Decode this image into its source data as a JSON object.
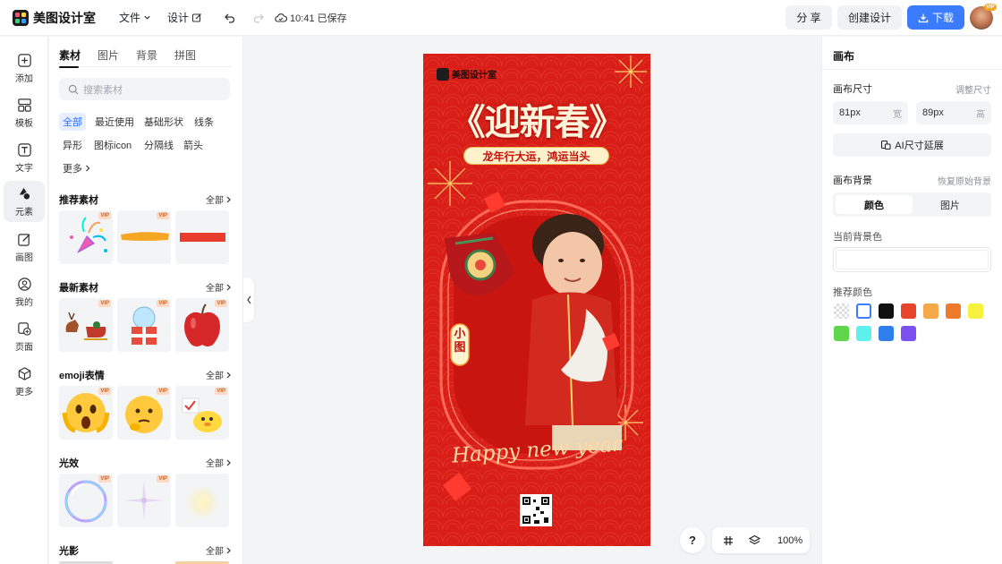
{
  "header": {
    "app_name": "美图设计室",
    "menu": {
      "file": "文件",
      "design": "设计"
    },
    "save_status": "10:41 已保存",
    "share_label": "分 享",
    "create_label": "创建设计",
    "download_label": "下载",
    "avatar_badge": "VIP"
  },
  "rail": [
    {
      "label": "添加",
      "icon": "plus-square-icon"
    },
    {
      "label": "模板",
      "icon": "template-icon"
    },
    {
      "label": "文字",
      "icon": "text-icon"
    },
    {
      "label": "元素",
      "icon": "shapes-icon"
    },
    {
      "label": "画图",
      "icon": "draw-icon"
    },
    {
      "label": "我的",
      "icon": "user-icon"
    },
    {
      "label": "页面",
      "icon": "page-add-icon"
    },
    {
      "label": "更多",
      "icon": "cube-icon"
    }
  ],
  "panel": {
    "tabs": [
      "素材",
      "图片",
      "背景",
      "拼图"
    ],
    "search_placeholder": "搜索素材",
    "chips": [
      "全部",
      "最近使用",
      "基础形状",
      "线条",
      "异形",
      "图标icon",
      "分隔线",
      "箭头",
      "更多"
    ],
    "all_label": "全部",
    "vip": "VIP",
    "sections": [
      {
        "title": "推荐素材",
        "items": [
          "party-popper",
          "yellow-brush-stroke",
          "red-bar"
        ]
      },
      {
        "title": "最新素材",
        "items": [
          "reindeer-sleigh",
          "snow-globe-gift",
          "red-apple"
        ]
      },
      {
        "title": "emoji表情",
        "items": [
          "shocked-emoji",
          "thinking-emoji",
          "duck-emoji"
        ]
      },
      {
        "title": "光效",
        "items": [
          "bubble-ring",
          "sparkle-star",
          "soft-glow"
        ]
      },
      {
        "title": "光影",
        "items": []
      }
    ]
  },
  "canvas": {
    "brand": "美图设计室",
    "headline": "《迎新春》",
    "banner": "龙年行大运，鸿运当头",
    "tag": "小图",
    "script": "Happy new year",
    "accent": "#d81e17"
  },
  "bottom": {
    "help": "?",
    "zoom": "100%"
  },
  "right": {
    "title": "画布",
    "size_label": "画布尺寸",
    "size_action": "调整尺寸",
    "width_value": "81px",
    "width_unit": "宽",
    "height_value": "89px",
    "height_unit": "高",
    "ai_extend_label": "AI尺寸延展",
    "bg_label": "画布背景",
    "bg_action": "恢复原始背景",
    "seg_color": "颜色",
    "seg_image": "图片",
    "current_bg_label": "当前背景色",
    "recommend_label": "推荐颜色",
    "swatches": [
      "transparent",
      "#ffffff",
      "#111111",
      "#e8432b",
      "#f5a84a",
      "#f07a2c",
      "#f6f13c",
      "#5ed54a",
      "#5ef0ec",
      "#2f80ed",
      "#7b4ff0"
    ]
  }
}
